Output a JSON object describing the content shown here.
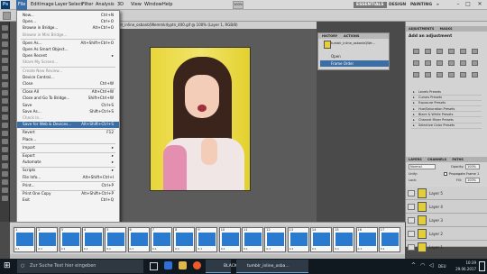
{
  "menubar": {
    "items": [
      "File",
      "Edit",
      "Image",
      "Layer",
      "Select",
      "Filter",
      "Analysis",
      "3D",
      "View",
      "Window",
      "Help"
    ],
    "zoom": "100%",
    "workspaces": [
      "ESSENTIALS",
      "DESIGN",
      "PAINTING"
    ],
    "ws_more": "»",
    "window_controls": [
      "–",
      "□",
      "✕"
    ]
  },
  "document": {
    "tab_title": "tumblr_inline_osbanb[Wemmk4yptn_400.gif @ 100% (Layer 1, RGB/8)"
  },
  "file_menu": {
    "items": [
      {
        "label": "New...",
        "shortcut": "Ctrl+N",
        "state": "normal"
      },
      {
        "label": "Open...",
        "shortcut": "Ctrl+O",
        "state": "normal"
      },
      {
        "label": "Browse in Bridge...",
        "shortcut": "Alt+Ctrl+O",
        "state": "normal"
      },
      {
        "label": "Browse in Mini Bridge...",
        "shortcut": "",
        "state": "disabled"
      },
      {
        "label": "Open As...",
        "shortcut": "Alt+Shift+Ctrl+O",
        "state": "normal"
      },
      {
        "label": "Open As Smart Object...",
        "shortcut": "",
        "state": "normal"
      },
      {
        "label": "Open Recent",
        "shortcut": "▸",
        "state": "normal"
      },
      {
        "label": "Share My Screen...",
        "shortcut": "",
        "state": "disabled"
      },
      {
        "label": "Create New Review...",
        "shortcut": "",
        "state": "disabled"
      },
      {
        "label": "Device Central...",
        "shortcut": "",
        "state": "normal"
      },
      {
        "label": "Close",
        "shortcut": "Ctrl+W",
        "state": "normal"
      },
      {
        "label": "Close All",
        "shortcut": "Alt+Ctrl+W",
        "state": "normal"
      },
      {
        "label": "Close and Go To Bridge...",
        "shortcut": "Shift+Ctrl+W",
        "state": "normal"
      },
      {
        "label": "Save",
        "shortcut": "Ctrl+S",
        "state": "normal"
      },
      {
        "label": "Save As...",
        "shortcut": "Shift+Ctrl+S",
        "state": "normal"
      },
      {
        "label": "Check In...",
        "shortcut": "",
        "state": "disabled"
      },
      {
        "label": "Save for Web & Devices...",
        "shortcut": "Alt+Shift+Ctrl+S",
        "state": "highlighted"
      },
      {
        "label": "Revert",
        "shortcut": "F12",
        "state": "normal"
      },
      {
        "label": "Place...",
        "shortcut": "",
        "state": "normal"
      },
      {
        "label": "Import",
        "shortcut": "▸",
        "state": "normal"
      },
      {
        "label": "Export",
        "shortcut": "▸",
        "state": "normal"
      },
      {
        "label": "Automate",
        "shortcut": "▸",
        "state": "normal"
      },
      {
        "label": "Scripts",
        "shortcut": "▸",
        "state": "normal"
      },
      {
        "label": "File Info...",
        "shortcut": "Alt+Shift+Ctrl+I",
        "state": "normal"
      },
      {
        "label": "Print...",
        "shortcut": "Ctrl+P",
        "state": "normal"
      },
      {
        "label": "Print One Copy",
        "shortcut": "Alt+Shift+Ctrl+P",
        "state": "normal"
      },
      {
        "label": "Exit",
        "shortcut": "Ctrl+Q",
        "state": "normal"
      }
    ]
  },
  "history": {
    "tabs": [
      "HISTORY",
      "ACTIONS"
    ],
    "snapshot": "tumblr_inline_osbanbQWe...",
    "rows": [
      "Open",
      "Frame Order"
    ]
  },
  "adjustments": {
    "tabs": [
      "ADJUSTMENTS",
      "MASKS"
    ],
    "title": "Add an adjustment",
    "presets": [
      "Levels Presets",
      "Curves Presets",
      "Exposure Presets",
      "Hue/Saturation Presets",
      "Black & White Presets",
      "Channel Mixer Presets",
      "Selective Color Presets"
    ]
  },
  "layers": {
    "tabs": [
      "LAYERS",
      "CHANNELS",
      "PATHS"
    ],
    "blend_mode": "Normal",
    "opacity_label": "Opacity:",
    "opacity": "100%",
    "unify_label": "Unify:",
    "propagate": "Propagate Frame 1",
    "lock_label": "Lock:",
    "fill_label": "Fill:",
    "fill": "100%",
    "items": [
      "Layer 5",
      "Layer 4",
      "Layer 3",
      "Layer 2",
      "Layer 1"
    ]
  },
  "animation": {
    "frames": [
      {
        "n": "1",
        "d": "0,1"
      },
      {
        "n": "2",
        "d": "0,1"
      },
      {
        "n": "3",
        "d": "0,1"
      },
      {
        "n": "4",
        "d": "0,1"
      },
      {
        "n": "5",
        "d": "0,1"
      },
      {
        "n": "6",
        "d": "0,1"
      },
      {
        "n": "7",
        "d": "0,1"
      },
      {
        "n": "8",
        "d": "0,1"
      },
      {
        "n": "9",
        "d": "0,1"
      },
      {
        "n": "10",
        "d": "0,1"
      },
      {
        "n": "11",
        "d": "0,1"
      },
      {
        "n": "12",
        "d": "0,1"
      },
      {
        "n": "13",
        "d": "0,1"
      },
      {
        "n": "14",
        "d": "0,1"
      },
      {
        "n": "15",
        "d": "0,1"
      },
      {
        "n": "16",
        "d": "0,1"
      },
      {
        "n": "17",
        "d": "0,1"
      }
    ]
  },
  "taskbar": {
    "search_placeholder": "Zur Suche Text hier eingeben",
    "tasks": [
      "BLACKPINK IN YO...",
      "tumblr_inline_osba..."
    ],
    "time": "10:39",
    "date": "29.06.2017",
    "lang": "DEU"
  }
}
